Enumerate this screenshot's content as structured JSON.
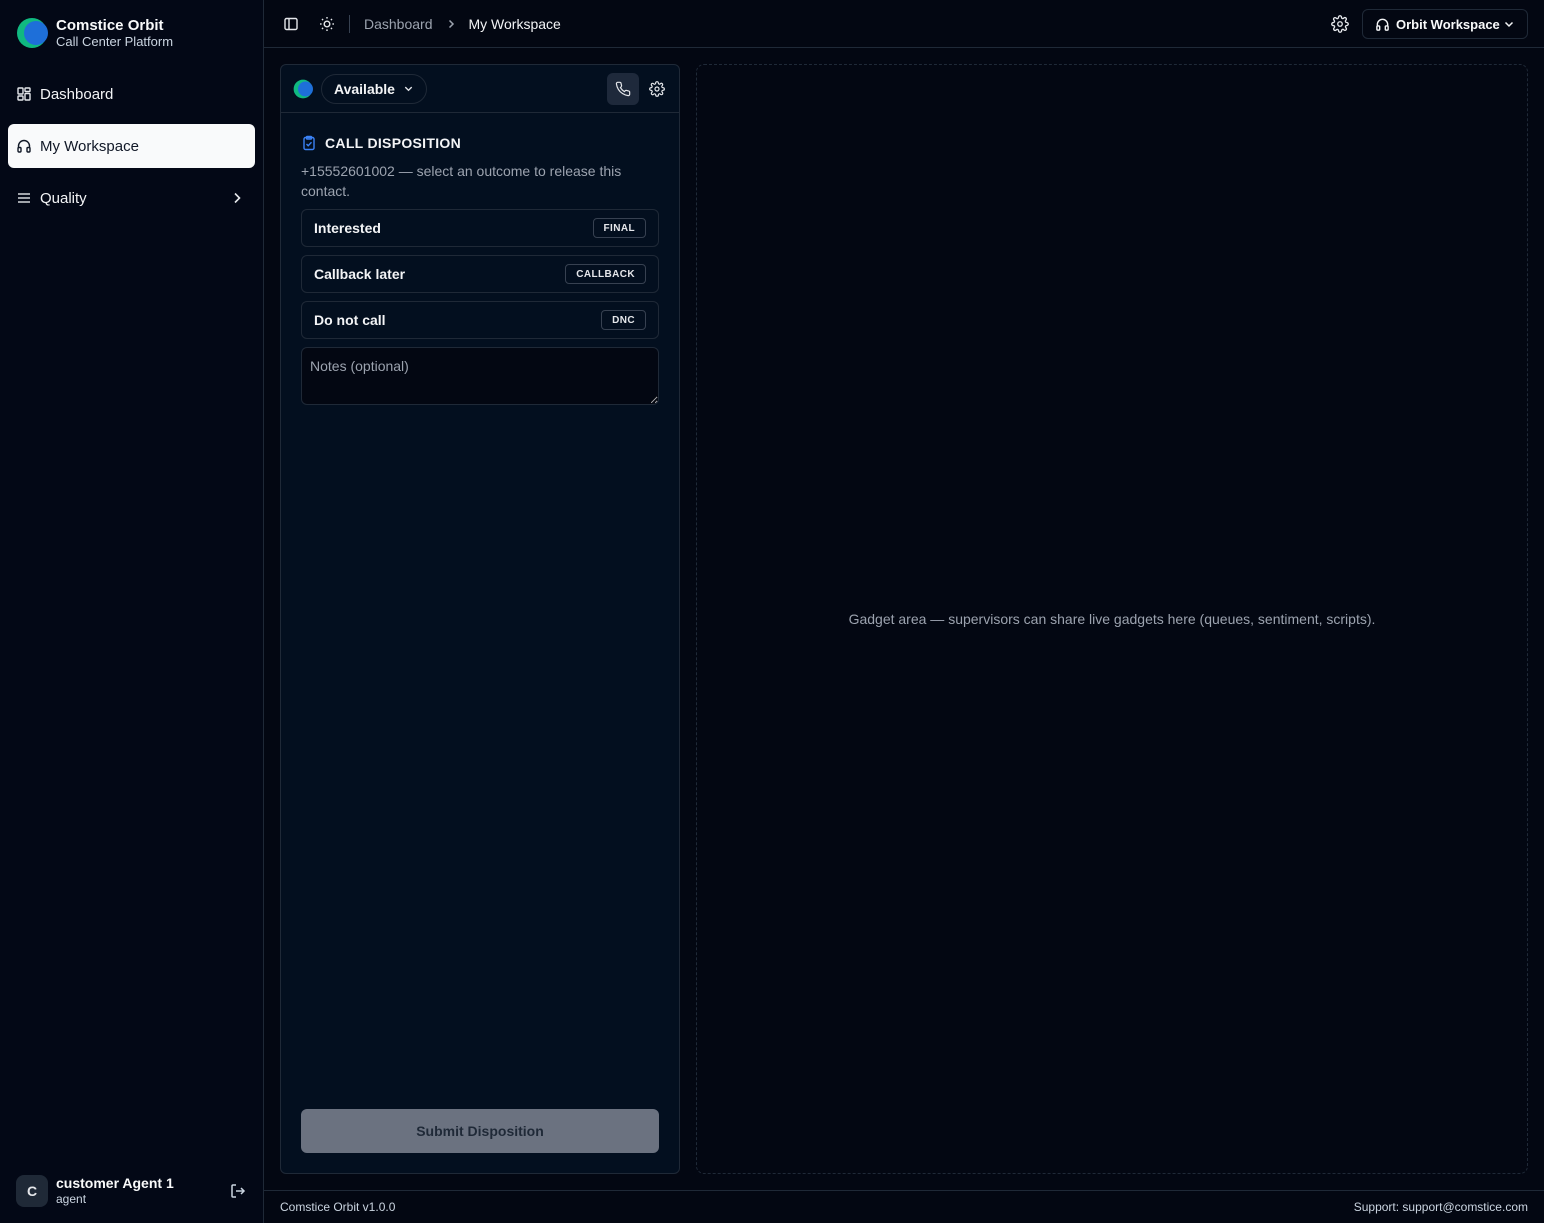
{
  "brand": {
    "title": "Comstice Orbit",
    "subtitle": "Call Center Platform"
  },
  "sidebar": {
    "items": [
      {
        "label": "Dashboard",
        "icon": "layout-grid-icon"
      },
      {
        "label": "My Workspace",
        "icon": "headphones-icon",
        "active": true
      },
      {
        "label": "Quality",
        "icon": "menu-icon"
      }
    ]
  },
  "user": {
    "initial": "C",
    "name": "customer Agent 1",
    "role": "agent"
  },
  "header": {
    "breadcrumb": {
      "parent": "Dashboard",
      "current": "My Workspace"
    },
    "workspace_label": "Orbit Workspace"
  },
  "softphone": {
    "status": "Available",
    "disposition": {
      "title": "CALL DISPOSITION",
      "description": "+15552601002 — select an outcome to release this contact.",
      "options": [
        {
          "label": "Interested",
          "badge": "FINAL"
        },
        {
          "label": "Callback later",
          "badge": "CALLBACK"
        },
        {
          "label": "Do not call",
          "badge": "DNC"
        }
      ],
      "notes_placeholder": "Notes (optional)",
      "notes_value": "",
      "submit_label": "Submit Disposition"
    }
  },
  "gadget": {
    "text": "Gadget area — supervisors can share live gadgets here (queues, sentiment, scripts)."
  },
  "footer": {
    "version": "Comstice Orbit v1.0.0",
    "support": "Support: support@comstice.com"
  },
  "colors": {
    "background": "#030712",
    "sidebar": "#030816",
    "panel": "#030f1f",
    "accent_blue": "#1e6fd9",
    "accent_teal": "#10b981",
    "submit_disabled": "#6b7280"
  }
}
